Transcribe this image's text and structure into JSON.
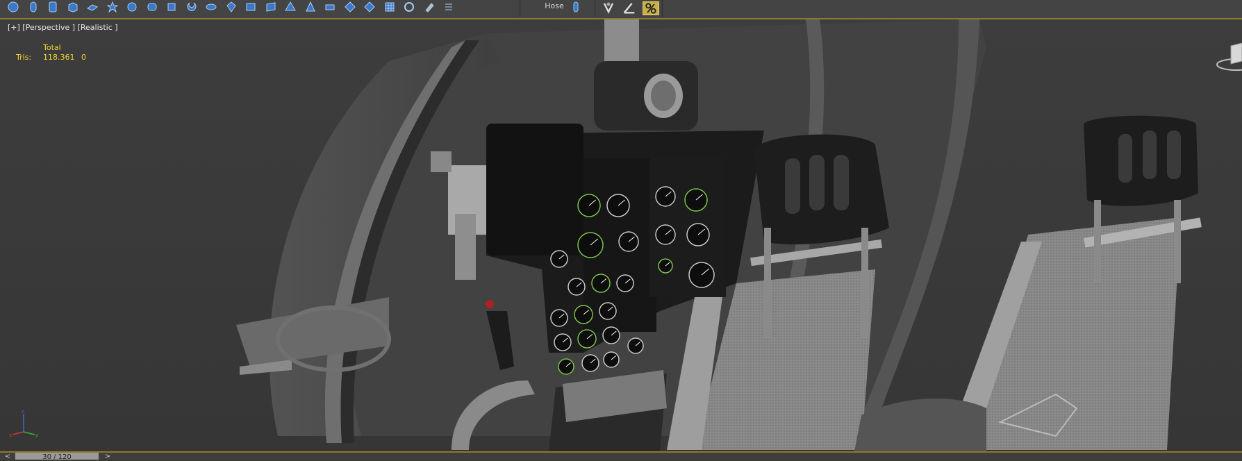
{
  "toolbar": {
    "tools": [
      {
        "icon": "sphere-icon",
        "color": "#3a78c8"
      },
      {
        "icon": "cylinder-icon",
        "color": "#3a78c8"
      },
      {
        "icon": "tube-icon",
        "color": "#3a78c8"
      },
      {
        "icon": "box-icon",
        "color": "#3a78c8"
      },
      {
        "icon": "plane-icon",
        "color": "#3a78c8"
      },
      {
        "icon": "geosphere-icon",
        "color": "#3a78c8"
      },
      {
        "icon": "torus-knot-icon",
        "color": "#3a78c8"
      },
      {
        "icon": "chamfer-cylinder-icon",
        "color": "#3a78c8"
      },
      {
        "icon": "oil-tank-icon",
        "color": "#3a78c8"
      },
      {
        "icon": "capsule-icon",
        "color": "#3a78c8"
      },
      {
        "icon": "torus-icon",
        "color": "#3a78c8"
      },
      {
        "icon": "spindle-icon",
        "color": "#3a78c8"
      },
      {
        "icon": "l-ext-icon",
        "color": "#3a78c8"
      },
      {
        "icon": "c-ext-icon",
        "color": "#3a78c8"
      },
      {
        "icon": "hedra-icon",
        "color": "#3a78c8"
      },
      {
        "icon": "pyramid-icon",
        "color": "#3a78c8"
      },
      {
        "icon": "prism-icon",
        "color": "#3a78c8"
      },
      {
        "icon": "gengon-icon",
        "color": "#3a78c8"
      },
      {
        "icon": "ringwave-icon",
        "color": "#3a78c8"
      },
      {
        "icon": "grid-icon",
        "color": "#3a78c8"
      },
      {
        "icon": "gear-ring-icon",
        "color": "#3a78c8"
      },
      {
        "icon": "eraser-icon",
        "color": "#bbbbbb"
      },
      {
        "icon": "spring-icon",
        "color": "#bbbbbb"
      }
    ],
    "hose_label": "Hose",
    "hose_icon": "hose-icon",
    "snap_icons": [
      "snap-toggle-icon",
      "angle-snap-icon",
      "percent-snap-icon"
    ],
    "accent_color": "#c9b04a"
  },
  "viewport": {
    "label": "[+] [Perspective ] [Realistic ]",
    "stats": {
      "header": "Total",
      "tris_label": "Tris:",
      "tris_total": "118.361",
      "tris_selected": "0"
    },
    "background_color": "#3b3b3b",
    "stats_color": "#f0d430"
  },
  "timeline": {
    "frame_display": "30 / 120",
    "prev_label": "<",
    "next_label": ">"
  }
}
